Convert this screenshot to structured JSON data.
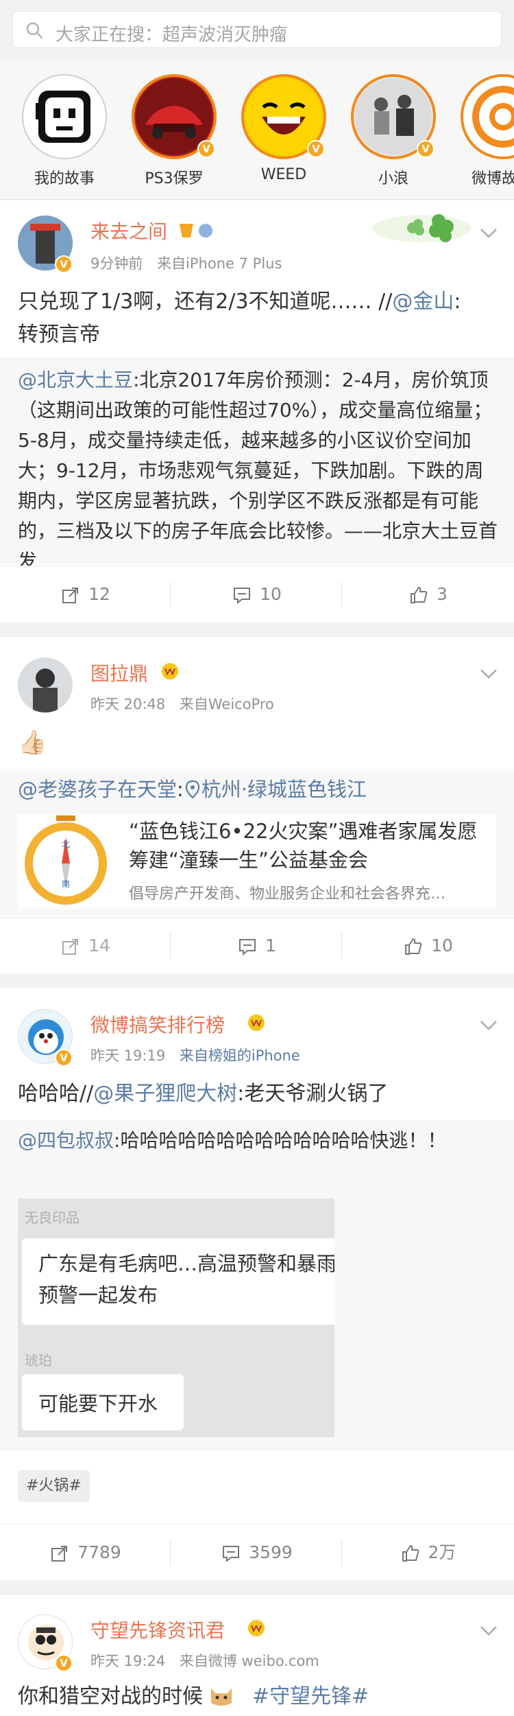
{
  "search": {
    "placeholder": "大家正在搜：超声波消灭肿瘤"
  },
  "stories": [
    {
      "label": "我的故事"
    },
    {
      "label": "PS3保罗"
    },
    {
      "label": "WEED"
    },
    {
      "label": "小浪"
    },
    {
      "label": "微博故"
    }
  ],
  "posts": [
    {
      "user": "来去之间",
      "time": "9分钟前",
      "source": "来自iPhone 7 Plus",
      "text_prefix": "只兑现了1/3啊，还有2/3不知道呢…… //",
      "mention": "@金山",
      "text_suffix": ":",
      "text_line2": "转预言帝",
      "repost_mention": "@北京大土豆",
      "repost_text": ":北京2017年房价预测：2-4月，房价筑顶（这期间出政策的可能性超过70%），成交量高位缩量；5-8月，成交量持续走低，越来越多的小区议价空间加大；9-12月，市场悲观气氛蔓延，下跌加剧。下跌的周期内，学区房显著抗跌，个别学区不跌反涨都是有可能的，三档及以下的房子年底会比较惨。——北京大土豆首发",
      "reposts": "12",
      "comments": "10",
      "likes": "3"
    },
    {
      "user": "图拉鼎",
      "time": "昨天 20:48",
      "source": "来自WeicoPro",
      "text": "👍🏻",
      "repost_mention": "@老婆孩子在天堂",
      "repost_location": "杭州·绿城蓝色钱江",
      "link_title": "“蓝色钱江6•22火灾案”遇难者家属发愿筹建“潼臻一生”公益基金会",
      "link_desc": "倡导房产开发商、物业服务企业和社会各界充…",
      "reposts": "14",
      "comments": "1",
      "likes": "10"
    },
    {
      "user": "微博搞笑排行榜",
      "time": "昨天 19:19",
      "source": "来自榜姐的iPhone",
      "text_prefix": "哈哈哈//",
      "mention": "@果子狸爬大树",
      "text_suffix": ":老天爷涮火锅了",
      "repost_mention": "@四包叔叔",
      "repost_text": ":哈哈哈哈哈哈哈哈哈哈哈哈哈快逃！！",
      "chat": [
        {
          "name": "无良印品",
          "msg": "广东是有毛病吧…高温预警和暴雨预警一起发布"
        },
        {
          "name": "琥珀",
          "msg": "可能要下开水"
        }
      ],
      "tag": "#火锅#",
      "reposts": "7789",
      "comments": "3599",
      "likes": "2万"
    },
    {
      "user": "守望先锋资讯君",
      "time": "昨天 19:24",
      "source": "来自微博 weibo.com",
      "text": "你和猎空对战的时候",
      "hashtag": "#守望先锋#"
    }
  ],
  "colors": {
    "username": "#eb7350",
    "link": "#5b7ca5",
    "verified": "#f6a623"
  }
}
